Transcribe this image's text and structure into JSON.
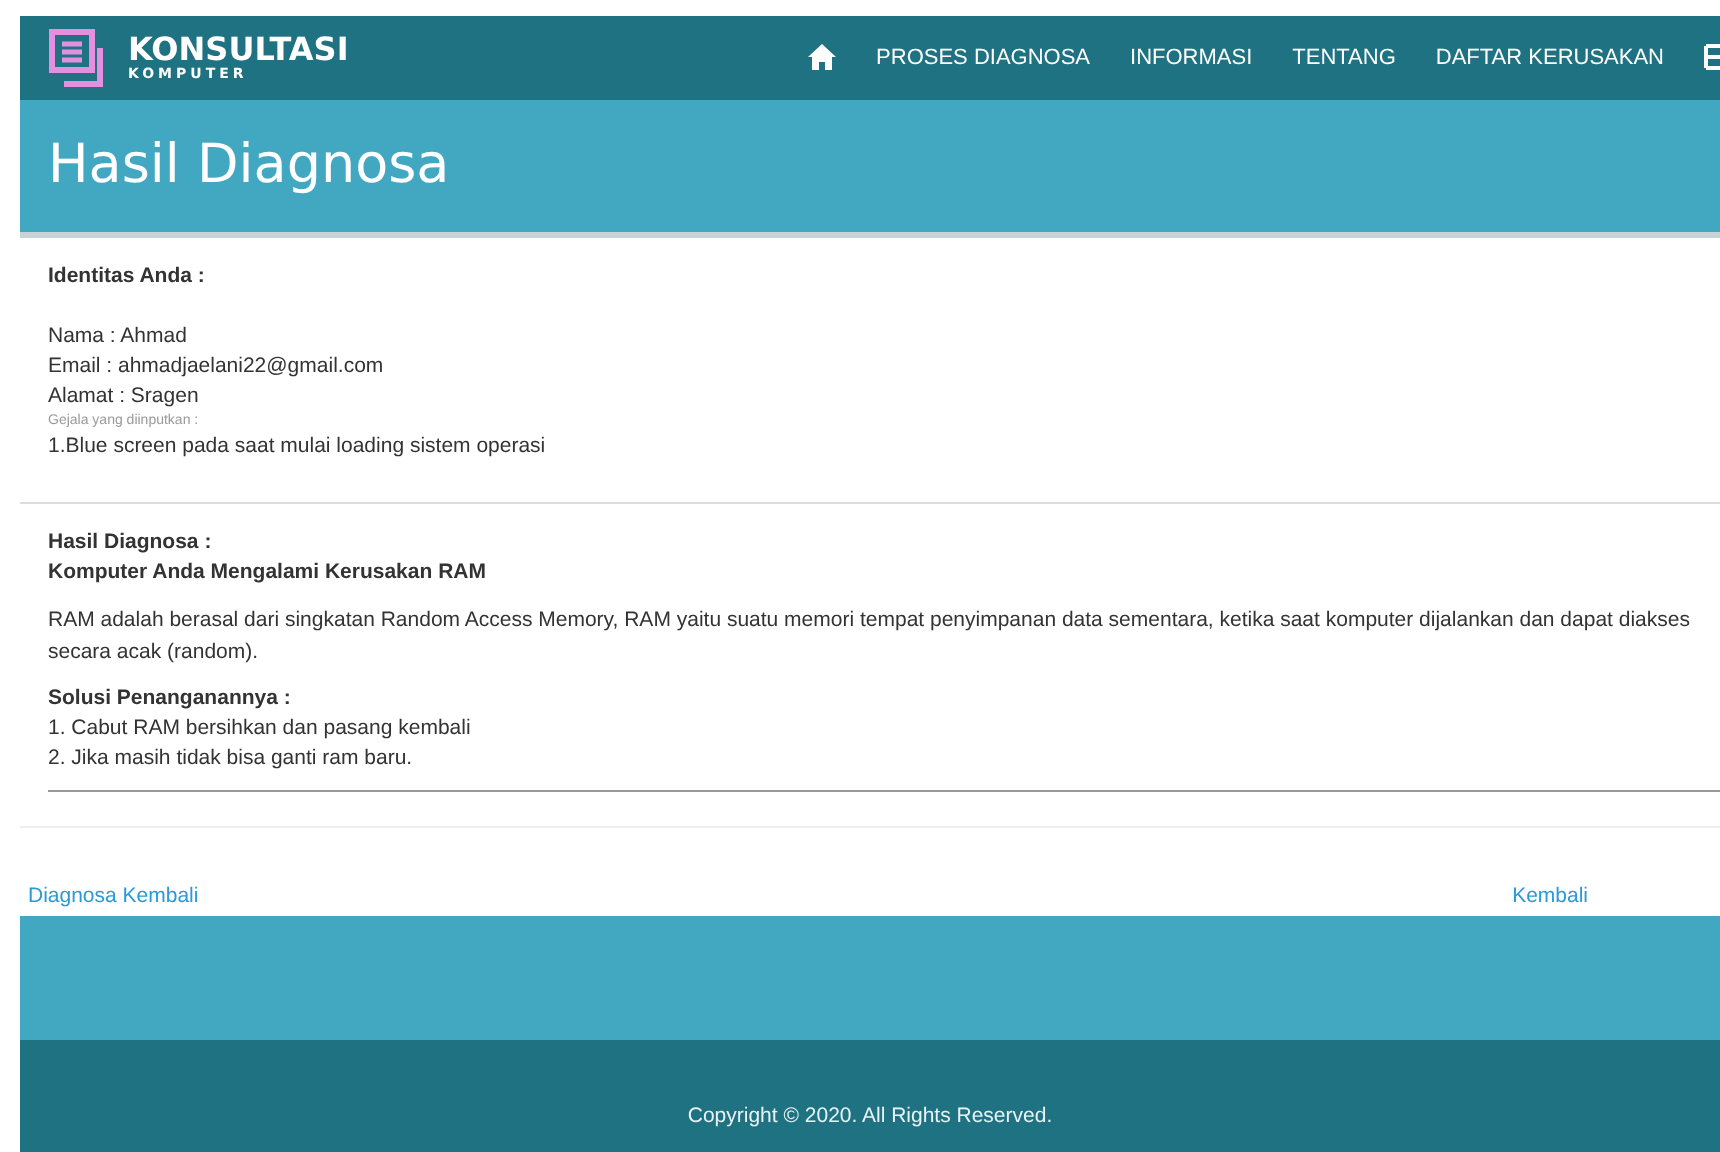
{
  "brand": {
    "title": "KONSULTASI",
    "subtitle": "KOMPUTER"
  },
  "nav": [
    {
      "label": "PROSES DIAGNOSA"
    },
    {
      "label": "INFORMASI"
    },
    {
      "label": "TENTANG"
    },
    {
      "label": "DAFTAR KERUSAKAN"
    }
  ],
  "page_title": "Hasil Diagnosa",
  "identity": {
    "heading": "Identitas Anda :",
    "lines": [
      "Nama : Ahmad",
      "Email : ahmadjaelani22@gmail.com",
      "Alamat : Sragen"
    ],
    "symptoms_label": "Gejala yang diinputkan :",
    "symptoms": [
      "1.Blue screen pada saat mulai loading sistem operasi"
    ]
  },
  "result": {
    "heading": "Hasil Diagnosa :",
    "diagnosis": "Komputer Anda Mengalami Kerusakan RAM",
    "description": "RAM adalah berasal dari singkatan Random Access Memory, RAM yaitu suatu memori tempat penyimpanan data sementara, ketika saat komputer dijalankan dan dapat diakses secara acak (random).",
    "solution_heading": "Solusi Penanganannya :",
    "solutions": [
      "1. Cabut RAM bersihkan dan pasang kembali",
      "2. Jika masih tidak bisa ganti ram baru."
    ]
  },
  "links": {
    "left": "Diagnosa Kembali",
    "right": "Kembali"
  },
  "footer": "Copyright © 2020. All Rights Reserved."
}
